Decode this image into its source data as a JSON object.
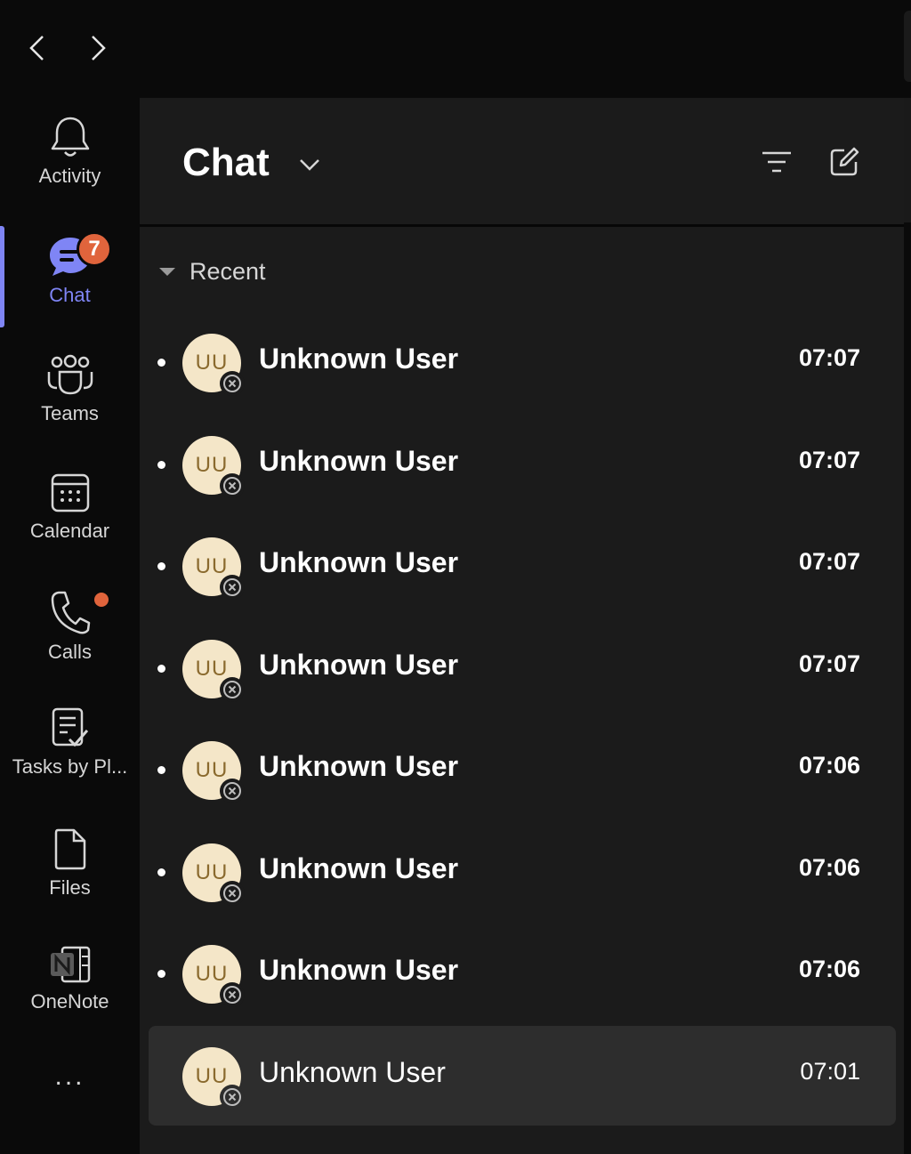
{
  "nav": {
    "back_icon": "chevron-left-icon",
    "forward_icon": "chevron-right-icon"
  },
  "rail": {
    "items": [
      {
        "label": "Activity",
        "icon": "bell-icon",
        "active": false
      },
      {
        "label": "Chat",
        "icon": "chat-icon",
        "active": true,
        "badge": "7"
      },
      {
        "label": "Teams",
        "icon": "teams-icon",
        "active": false
      },
      {
        "label": "Calendar",
        "icon": "calendar-icon",
        "active": false
      },
      {
        "label": "Calls",
        "icon": "phone-icon",
        "active": false,
        "dot": true
      },
      {
        "label": "Tasks by Pl...",
        "icon": "tasks-icon",
        "active": false
      },
      {
        "label": "Files",
        "icon": "file-icon",
        "active": false
      },
      {
        "label": "OneNote",
        "icon": "onenote-icon",
        "active": false
      }
    ],
    "more_label": "..."
  },
  "pane": {
    "title": "Chat",
    "section_label": "Recent",
    "chats": [
      {
        "initials": "UU",
        "name": "Unknown User",
        "time": "07:07",
        "unread": true
      },
      {
        "initials": "UU",
        "name": "Unknown User",
        "time": "07:07",
        "unread": true
      },
      {
        "initials": "UU",
        "name": "Unknown User",
        "time": "07:07",
        "unread": true
      },
      {
        "initials": "UU",
        "name": "Unknown User",
        "time": "07:07",
        "unread": true
      },
      {
        "initials": "UU",
        "name": "Unknown User",
        "time": "07:06",
        "unread": true
      },
      {
        "initials": "UU",
        "name": "Unknown User",
        "time": "07:06",
        "unread": true
      },
      {
        "initials": "UU",
        "name": "Unknown User",
        "time": "07:06",
        "unread": true
      },
      {
        "initials": "UU",
        "name": "Unknown User",
        "time": "07:01",
        "unread": false,
        "selected": true
      }
    ]
  },
  "colors": {
    "accent": "#7f85f5",
    "badge": "#e0643c",
    "avatar_bg": "#f4e6c8",
    "avatar_text": "#8a6a2e"
  }
}
